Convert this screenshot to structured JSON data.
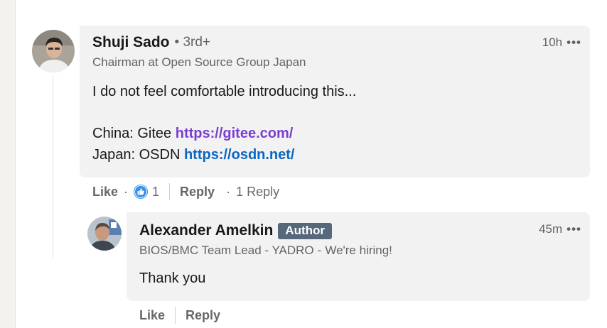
{
  "comment": {
    "author_name": "Shuji Sado",
    "degree": "• 3rd+",
    "headline": "Chairman at Open Source Group Japan",
    "time": "10h",
    "more_icon": "ellipsis-icon",
    "text_line1": "I do not feel comfortable introducing this...",
    "line2_prefix": "China: Gitee ",
    "line2_link": "https://gitee.com/",
    "line3_prefix": "Japan: OSDN ",
    "line3_link": "https://osdn.net/",
    "like_label": "Like",
    "reaction_icon": "thumbs-up-reaction-icon",
    "reaction_count": "1",
    "reply_label": "Reply",
    "reply_count": "1 Reply"
  },
  "reply": {
    "author_name": "Alexander Amelkin",
    "badge": "Author",
    "headline_role": "BIOS/BMC Team Lead - YADRO",
    "headline_sep": "-",
    "headline_hiring": "We're hiring!",
    "time": "45m",
    "more_icon": "ellipsis-icon",
    "text": "Thank you",
    "like_label": "Like",
    "reply_label": "Reply"
  },
  "colors": {
    "bubble": "#f2f2f2",
    "link_purple": "#7a3fd1",
    "link_blue": "#0a66c2",
    "badge_bg": "#56687a",
    "reaction_blue": "#378fe9"
  }
}
